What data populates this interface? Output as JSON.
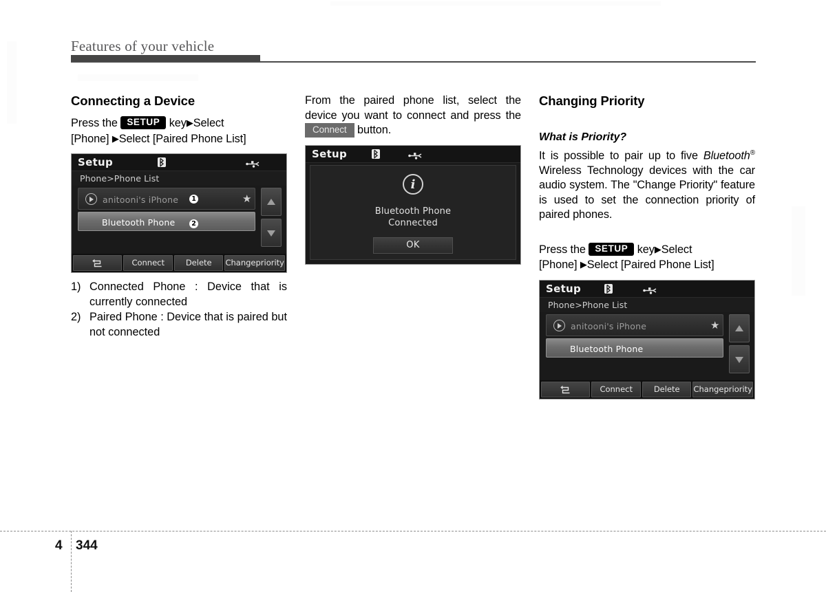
{
  "page": {
    "running_head": "Features of your vehicle",
    "chapter_number": "4",
    "page_number": "344"
  },
  "columns": {
    "left": {
      "heading": "Connecting a Device",
      "instruction_pre": "Press    the",
      "setup_key": "SETUP",
      "instruction_post": "key",
      "arrow": "▶",
      "instruction_line1_tail": "Select",
      "instruction_line2": "[Phone]",
      "instruction_line2_tail": "Select [Paired Phone List]",
      "notes": [
        {
          "marker": "1)",
          "text": "Connected Phone : Device that is currently connected"
        },
        {
          "marker": "2)",
          "text": "Paired Phone : Device that is paired but not connected"
        }
      ]
    },
    "middle": {
      "paragraph_pre": "From the paired phone list, select the device you want to connect and press the",
      "connect_badge": "Connect",
      "paragraph_post": "button."
    },
    "right": {
      "heading": "Changing Priority",
      "subheading": "What is Priority?",
      "paragraph_1": "It is possible to pair up to five",
      "bluetooth_word": "Bluetooth",
      "bluetooth_sup": "®",
      "paragraph_2": "Wireless Technology devices with the car audio system. The \"Change Priority\" feature is used to set the connection priority of paired phones.",
      "instruction_pre": "Press    the",
      "setup_key": "SETUP",
      "instruction_post": "key",
      "arrow": "▶",
      "instruction_line1_tail": "Select",
      "instruction_line2": "[Phone]",
      "instruction_line2_tail": "Select [Paired Phone List]"
    }
  },
  "screens": {
    "phone_list_left": {
      "title": "Setup",
      "breadcrumb": "Phone>Phone List",
      "status_icons": [
        "bluetooth-icon",
        "usb-icon"
      ],
      "rows": [
        {
          "label": "anitooni's iPhone",
          "state": "connected",
          "badge": "❶",
          "starred": true,
          "play_icon": true
        },
        {
          "label": "Bluetooth Phone",
          "state": "paired",
          "badge": "❷",
          "starred": false,
          "play_icon": false
        }
      ],
      "scroll_up": "▲",
      "scroll_down": "▼",
      "toolbar": [
        {
          "name": "back",
          "label": "",
          "icon": "back-arrow-icon"
        },
        {
          "name": "connect",
          "label": "Connect"
        },
        {
          "name": "delete",
          "label": "Delete"
        },
        {
          "name": "change-priority",
          "label_line1": "Change",
          "label_line2": "priority"
        }
      ]
    },
    "connected_dialog": {
      "title": "Setup",
      "status_icons": [
        "bluetooth-icon",
        "usb-icon"
      ],
      "info_glyph": "i",
      "message_line1": "Bluetooth Phone",
      "message_line2": "Connected",
      "ok_label": "OK"
    },
    "phone_list_right": {
      "title": "Setup",
      "breadcrumb": "Phone>Phone List",
      "status_icons": [
        "bluetooth-icon",
        "usb-icon"
      ],
      "rows": [
        {
          "label": "anitooni's iPhone",
          "state": "connected",
          "starred": true,
          "play_icon": true
        },
        {
          "label": "Bluetooth Phone",
          "state": "paired",
          "starred": false,
          "play_icon": false
        }
      ],
      "scroll_up": "▲",
      "scroll_down": "▼",
      "toolbar": [
        {
          "name": "back",
          "label": "",
          "icon": "back-arrow-icon"
        },
        {
          "name": "connect",
          "label": "Connect"
        },
        {
          "name": "delete",
          "label": "Delete"
        },
        {
          "name": "change-priority",
          "label_line1": "Change",
          "label_line2": "priority"
        }
      ]
    }
  },
  "colors": {
    "rule": "#454545",
    "running_head": "#58585a",
    "key_badge_bg": "#000000",
    "screen_bg": "#1a1a1a"
  }
}
